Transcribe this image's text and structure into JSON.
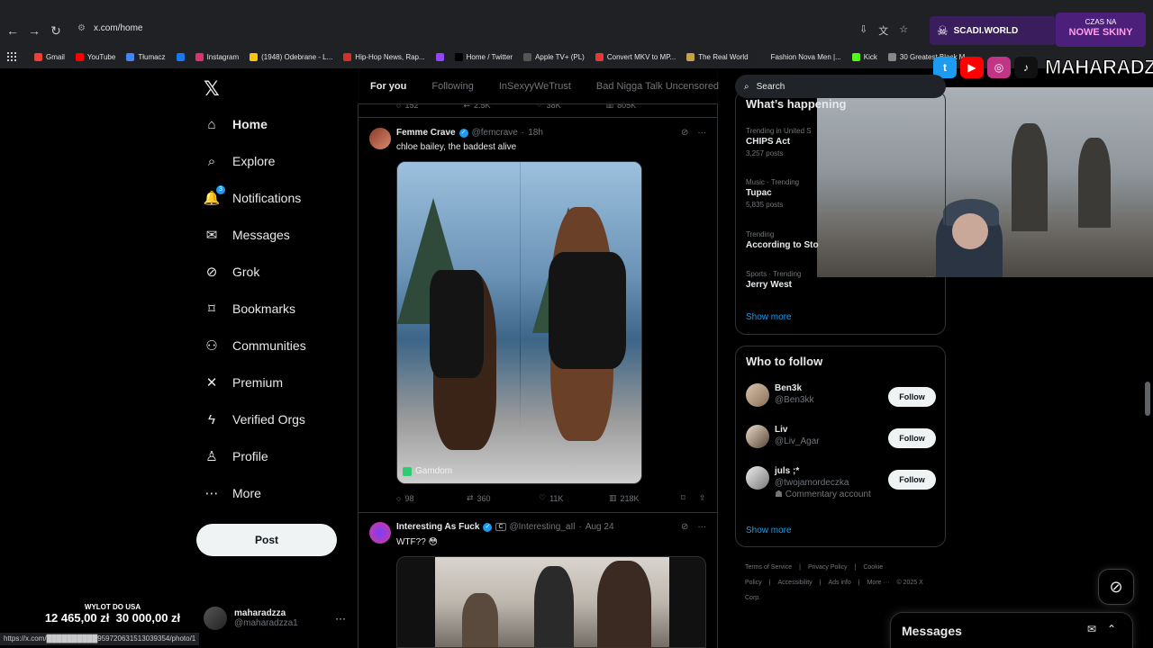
{
  "browser": {
    "url": "x.com/home",
    "status_url": "https://x.com/██████████959720631513039354/photo/1",
    "bookmarks": [
      {
        "label": "Gmail",
        "color": "#ea4335"
      },
      {
        "label": "YouTube",
        "color": "#ff0000"
      },
      {
        "label": "Tłumacz",
        "color": "#4285f4"
      },
      {
        "label": "",
        "color": "#1877f2"
      },
      {
        "label": "Instagram",
        "color": "#e1306c"
      },
      {
        "label": "(1948) Odebrane - L...",
        "color": "#f9c513"
      },
      {
        "label": "Hip-Hop News, Rap...",
        "color": "#d93025"
      },
      {
        "label": "",
        "color": "#9146ff"
      },
      {
        "label": "Home / Twitter",
        "color": "#000000"
      },
      {
        "label": "Apple TV+ (PL)",
        "color": "#555555"
      },
      {
        "label": "Convert MKV to MP...",
        "color": "#e53935"
      },
      {
        "label": "The Real World",
        "color": "#c7a04a"
      },
      {
        "label": "Fashion Nova Men |...",
        "color": "#222222"
      },
      {
        "label": "Kick",
        "color": "#53fc18"
      },
      {
        "label": "30 Greatest Black M...",
        "color": "#888888"
      }
    ]
  },
  "overlay": {
    "scadi": "SCADI.WORLD",
    "skins_top": "CZAS NA",
    "skins_bottom": "NOWE SKINY",
    "brand": "MAHARADZZA",
    "donation_title": "WYLOT DO USA",
    "donation_current": "12 465,00 zł",
    "donation_goal": "30 000,00 zł"
  },
  "nav": {
    "items": [
      {
        "label": "Home",
        "icon": "home-icon",
        "glyph": "⌂"
      },
      {
        "label": "Explore",
        "icon": "search-icon",
        "glyph": "⌕"
      },
      {
        "label": "Notifications",
        "icon": "bell-icon",
        "glyph": "🔔",
        "badge": "3"
      },
      {
        "label": "Messages",
        "icon": "envelope-icon",
        "glyph": "✉"
      },
      {
        "label": "Grok",
        "icon": "grok-icon",
        "glyph": "⊘"
      },
      {
        "label": "Bookmarks",
        "icon": "bookmark-icon",
        "glyph": "⌑"
      },
      {
        "label": "Communities",
        "icon": "people-icon",
        "glyph": "⚇"
      },
      {
        "label": "Premium",
        "icon": "x-icon",
        "glyph": "✕"
      },
      {
        "label": "Verified Orgs",
        "icon": "lightning-icon",
        "glyph": "ϟ"
      },
      {
        "label": "Profile",
        "icon": "person-icon",
        "glyph": "♙"
      },
      {
        "label": "More",
        "icon": "more-circle-icon",
        "glyph": "⋯"
      }
    ],
    "post_label": "Post",
    "account_name": "maharadzza",
    "account_handle": "@maharadzza1"
  },
  "tabs": [
    "For you",
    "Following",
    "InSexyyWeTrust",
    "Bad Nigga Talk Uncensored"
  ],
  "prev_tweet_stats": {
    "replies": "152",
    "reposts": "2.5K",
    "likes": "38K",
    "views": "805K"
  },
  "tweet1": {
    "name": "Femme Crave",
    "handle": "@femcrave",
    "time": "18h",
    "text": "chloe bailey, the baddest alive",
    "watermark": "Gamdom",
    "stats": {
      "replies": "98",
      "reposts": "360",
      "likes": "11K",
      "views": "218K"
    }
  },
  "tweet2": {
    "name": "Interesting As Fuck",
    "affiliate": "C",
    "handle": "@Interesting_aIl",
    "time": "Aug 24",
    "text": "WTF?? 😳"
  },
  "search_placeholder": "Search",
  "trends": {
    "title": "What’s happening",
    "items": [
      {
        "category": "Trending in United S",
        "name": "CHIPS Act",
        "count": "3,257 posts"
      },
      {
        "category": "Music · Trending",
        "name": "Tupac",
        "count": "5,835 posts"
      },
      {
        "category": "Trending",
        "name": "According to Sto",
        "count": ""
      },
      {
        "category": "Sports · Trending",
        "name": "Jerry West",
        "count": ""
      }
    ],
    "show_more": "Show more"
  },
  "who_to_follow": {
    "title": "Who to follow",
    "items": [
      {
        "name": "Ben3k",
        "handle": "@Ben3kk",
        "extra": ""
      },
      {
        "name": "Liv",
        "handle": "@Liv_Agar",
        "extra": ""
      },
      {
        "name": "juls ;*",
        "handle": "@twojamordeczka",
        "extra": "Commentary account"
      }
    ],
    "follow_label": "Follow",
    "show_more": "Show more"
  },
  "footer": {
    "links": [
      "Terms of Service",
      "|",
      "Privacy Policy",
      "|",
      "Cookie Policy",
      "|",
      "Accessibility",
      "|",
      "Ads info",
      "|",
      "More ···",
      "© 2025 X Corp."
    ]
  },
  "messages_drawer": {
    "title": "Messages"
  },
  "colors": {
    "accent": "#1d9bf0",
    "bg": "#000000",
    "border": "#2f3336",
    "muted": "#71767b"
  }
}
